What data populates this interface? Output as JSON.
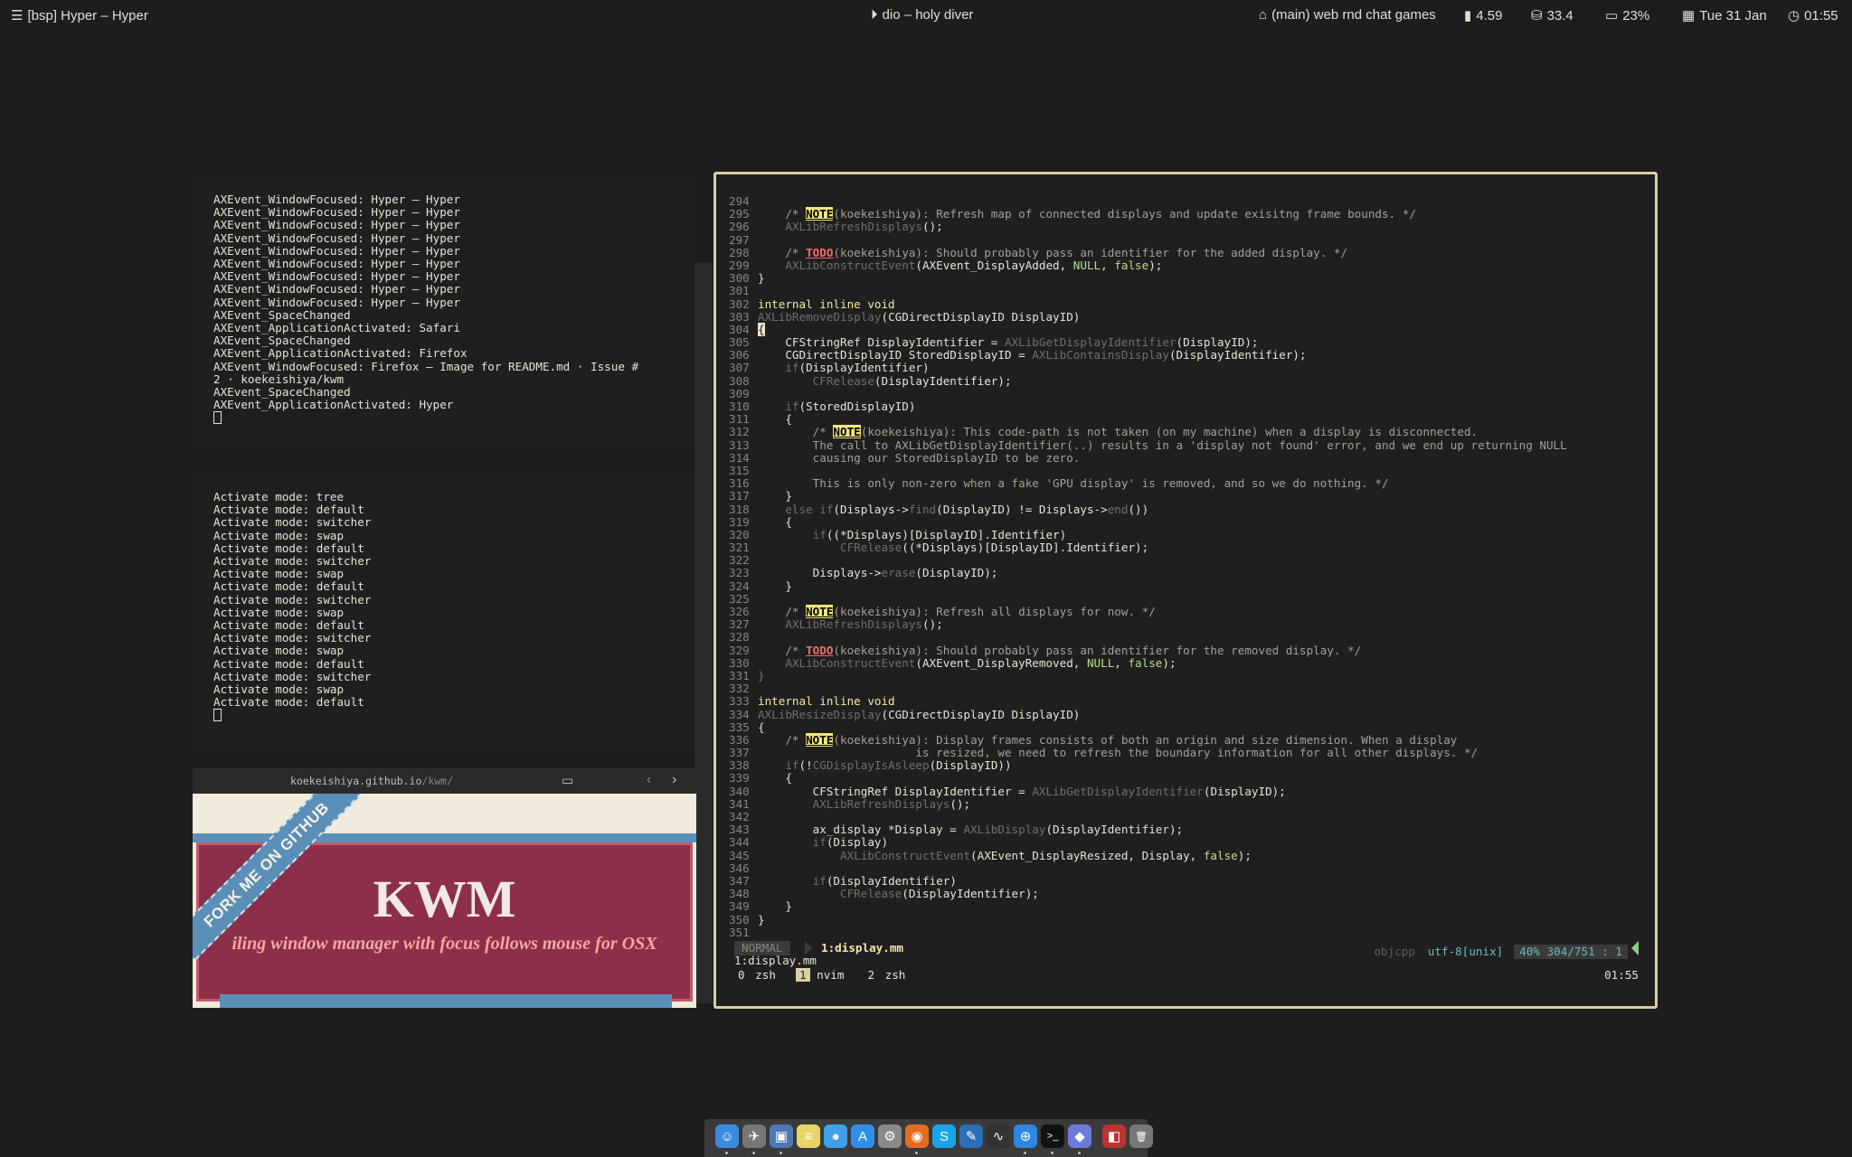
{
  "topbar": {
    "left_title": "[bsp] Hyper – Hyper",
    "now_playing": "dio – holy diver",
    "git_branch": "(main) web rnd chat games",
    "load": "4.59",
    "disk": "33.4",
    "battery": "23%",
    "date": "Tue 31 Jan",
    "time": "01:55"
  },
  "pane_events": {
    "lines": [
      "AXEvent_WindowFocused: Hyper – Hyper",
      "AXEvent_WindowFocused: Hyper – Hyper",
      "AXEvent_WindowFocused: Hyper – Hyper",
      "AXEvent_WindowFocused: Hyper – Hyper",
      "AXEvent_WindowFocused: Hyper – Hyper",
      "AXEvent_WindowFocused: Hyper – Hyper",
      "AXEvent_WindowFocused: Hyper – Hyper",
      "AXEvent_WindowFocused: Hyper – Hyper",
      "AXEvent_WindowFocused: Hyper – Hyper",
      "AXEvent_SpaceChanged",
      "AXEvent_ApplicationActivated: Safari",
      "AXEvent_SpaceChanged",
      "AXEvent_ApplicationActivated: Firefox",
      "AXEvent_WindowFocused: Firefox – Image for README.md · Issue #",
      "2 · koekeishiya/kwm",
      "AXEvent_SpaceChanged",
      "AXEvent_ApplicationActivated: Hyper"
    ]
  },
  "pane_modes": {
    "lines": [
      "Activate mode: tree",
      "Activate mode: default",
      "Activate mode: switcher",
      "Activate mode: swap",
      "Activate mode: default",
      "Activate mode: switcher",
      "Activate mode: swap",
      "Activate mode: default",
      "Activate mode: switcher",
      "Activate mode: swap",
      "Activate mode: default",
      "Activate mode: switcher",
      "Activate mode: swap",
      "Activate mode: default",
      "Activate mode: switcher",
      "Activate mode: swap",
      "Activate mode: default"
    ]
  },
  "browser": {
    "url_host": "koekeishiya.github.io",
    "url_path": "/kwm/",
    "page_title": "KWM",
    "page_subtitle": "iling window manager with focus follows mouse for OSX",
    "ribbon": "FORK ME ON GITHUB"
  },
  "editor": {
    "code_lines": [
      {
        "n": "294",
        "segs": []
      },
      {
        "n": "295",
        "segs": [
          {
            "t": "    /* ",
            "c": "cm"
          },
          {
            "t": "NOTE",
            "c": "note"
          },
          {
            "t": "(koekeishiya): Refresh map of connected displays and update exisitng frame bounds. */",
            "c": "cm"
          }
        ]
      },
      {
        "n": "296",
        "segs": [
          {
            "t": "    AXLibRefreshDisplays",
            "c": "fn"
          },
          {
            "t": "();",
            "c": ""
          }
        ]
      },
      {
        "n": "297",
        "segs": []
      },
      {
        "n": "298",
        "segs": [
          {
            "t": "    /* ",
            "c": "cm"
          },
          {
            "t": "TODO",
            "c": "todo"
          },
          {
            "t": "(koekeishiya): Should probably pass an identifier for the added display. */",
            "c": "cm"
          }
        ]
      },
      {
        "n": "299",
        "segs": [
          {
            "t": "    AXLibConstructEvent",
            "c": "fn"
          },
          {
            "t": "(AXEvent_DisplayAdded, ",
            "c": ""
          },
          {
            "t": "NULL",
            "c": "lit"
          },
          {
            "t": ", ",
            "c": ""
          },
          {
            "t": "false",
            "c": "lit"
          },
          {
            "t": ");",
            "c": ""
          }
        ]
      },
      {
        "n": "300",
        "segs": [
          {
            "t": "}",
            "c": ""
          }
        ]
      },
      {
        "n": "301",
        "segs": []
      },
      {
        "n": "302",
        "segs": [
          {
            "t": "internal inline void",
            "c": "kw"
          }
        ]
      },
      {
        "n": "303",
        "segs": [
          {
            "t": "AXLibRemoveDisplay",
            "c": "fn"
          },
          {
            "t": "(CGDirectDisplayID DisplayID)",
            "c": ""
          }
        ]
      },
      {
        "n": "304",
        "segs": [
          {
            "t": "{",
            "c": "cur"
          }
        ]
      },
      {
        "n": "305",
        "segs": [
          {
            "t": "    CFStringRef DisplayIdentifier = ",
            "c": ""
          },
          {
            "t": "AXLibGetDisplayIdentifier",
            "c": "fn"
          },
          {
            "t": "(DisplayID);",
            "c": ""
          }
        ]
      },
      {
        "n": "306",
        "segs": [
          {
            "t": "    CGDirectDisplayID StoredDisplayID = ",
            "c": ""
          },
          {
            "t": "AXLibContainsDisplay",
            "c": "fn"
          },
          {
            "t": "(DisplayIdentifier);",
            "c": ""
          }
        ]
      },
      {
        "n": "307",
        "segs": [
          {
            "t": "    ",
            "c": ""
          },
          {
            "t": "if",
            "c": "fn"
          },
          {
            "t": "(DisplayIdentifier)",
            "c": ""
          }
        ]
      },
      {
        "n": "308",
        "segs": [
          {
            "t": "        CFRelease",
            "c": "fn"
          },
          {
            "t": "(DisplayIdentifier);",
            "c": ""
          }
        ]
      },
      {
        "n": "309",
        "segs": []
      },
      {
        "n": "310",
        "segs": [
          {
            "t": "    ",
            "c": ""
          },
          {
            "t": "if",
            "c": "fn"
          },
          {
            "t": "(StoredDisplayID)",
            "c": ""
          }
        ]
      },
      {
        "n": "311",
        "segs": [
          {
            "t": "    {",
            "c": ""
          }
        ]
      },
      {
        "n": "312",
        "segs": [
          {
            "t": "        /* ",
            "c": "cm"
          },
          {
            "t": "NOTE",
            "c": "note"
          },
          {
            "t": "(koekeishiya): This code-path is not taken (on my machine) when a display is disconnected.",
            "c": "cm"
          }
        ]
      },
      {
        "n": "313",
        "segs": [
          {
            "t": "        The call to AXLibGetDisplayIdentifier(..) results in a 'display not found' error, and we end up returning NULL",
            "c": "cm"
          }
        ]
      },
      {
        "n": "314",
        "segs": [
          {
            "t": "        causing our StoredDisplayID to be zero.",
            "c": "cm"
          }
        ]
      },
      {
        "n": "315",
        "segs": []
      },
      {
        "n": "316",
        "segs": [
          {
            "t": "        This is only non-zero when a fake 'GPU display' is removed, and so we do nothing. */",
            "c": "cm"
          }
        ]
      },
      {
        "n": "317",
        "segs": [
          {
            "t": "    }",
            "c": ""
          }
        ]
      },
      {
        "n": "318",
        "segs": [
          {
            "t": "    else if",
            "c": "fn"
          },
          {
            "t": "(Displays->",
            "c": ""
          },
          {
            "t": "find",
            "c": "fn"
          },
          {
            "t": "(DisplayID) != Displays->",
            "c": ""
          },
          {
            "t": "end",
            "c": "fn"
          },
          {
            "t": "())",
            "c": ""
          }
        ]
      },
      {
        "n": "319",
        "segs": [
          {
            "t": "    {",
            "c": ""
          }
        ]
      },
      {
        "n": "320",
        "segs": [
          {
            "t": "        ",
            "c": ""
          },
          {
            "t": "if",
            "c": "fn"
          },
          {
            "t": "((*Displays)[DisplayID].Identifier)",
            "c": ""
          }
        ]
      },
      {
        "n": "321",
        "segs": [
          {
            "t": "            CFRelease",
            "c": "fn"
          },
          {
            "t": "((*Displays)[DisplayID].Identifier);",
            "c": ""
          }
        ]
      },
      {
        "n": "322",
        "segs": []
      },
      {
        "n": "323",
        "segs": [
          {
            "t": "        Displays->",
            "c": ""
          },
          {
            "t": "erase",
            "c": "fn"
          },
          {
            "t": "(DisplayID);",
            "c": ""
          }
        ]
      },
      {
        "n": "324",
        "segs": [
          {
            "t": "    }",
            "c": ""
          }
        ]
      },
      {
        "n": "325",
        "segs": []
      },
      {
        "n": "326",
        "segs": [
          {
            "t": "    /* ",
            "c": "cm"
          },
          {
            "t": "NOTE",
            "c": "note"
          },
          {
            "t": "(koekeishiya): Refresh all displays for now. */",
            "c": "cm"
          }
        ]
      },
      {
        "n": "327",
        "segs": [
          {
            "t": "    AXLibRefreshDisplays",
            "c": "fn"
          },
          {
            "t": "();",
            "c": ""
          }
        ]
      },
      {
        "n": "328",
        "segs": []
      },
      {
        "n": "329",
        "segs": [
          {
            "t": "    /* ",
            "c": "cm"
          },
          {
            "t": "TODO",
            "c": "todo"
          },
          {
            "t": "(koekeishiya): Should probably pass an identifier for the removed display. */",
            "c": "cm"
          }
        ]
      },
      {
        "n": "330",
        "segs": [
          {
            "t": "    AXLibConstructEvent",
            "c": "fn"
          },
          {
            "t": "(AXEvent_DisplayRemoved, ",
            "c": ""
          },
          {
            "t": "NULL",
            "c": "lit"
          },
          {
            "t": ", ",
            "c": ""
          },
          {
            "t": "false",
            "c": "lit"
          },
          {
            "t": ");",
            "c": ""
          }
        ]
      },
      {
        "n": "331",
        "segs": [
          {
            "t": "}",
            "c": "fn"
          }
        ]
      },
      {
        "n": "332",
        "segs": []
      },
      {
        "n": "333",
        "segs": [
          {
            "t": "internal inline void",
            "c": "kw"
          }
        ]
      },
      {
        "n": "334",
        "segs": [
          {
            "t": "AXLibResizeDisplay",
            "c": "fn"
          },
          {
            "t": "(CGDirectDisplayID DisplayID)",
            "c": ""
          }
        ]
      },
      {
        "n": "335",
        "segs": [
          {
            "t": "{",
            "c": ""
          }
        ]
      },
      {
        "n": "336",
        "segs": [
          {
            "t": "    /* ",
            "c": "cm"
          },
          {
            "t": "NOTE",
            "c": "note"
          },
          {
            "t": "(koekeishiya): Display frames consists of both an origin and size dimension. When a display",
            "c": "cm"
          }
        ]
      },
      {
        "n": "337",
        "segs": [
          {
            "t": "                       is resized, we need to refresh the boundary information for all other displays. */",
            "c": "cm"
          }
        ]
      },
      {
        "n": "338",
        "segs": [
          {
            "t": "    ",
            "c": ""
          },
          {
            "t": "if",
            "c": "fn"
          },
          {
            "t": "(!",
            "c": ""
          },
          {
            "t": "CGDisplayIsAsleep",
            "c": "fn"
          },
          {
            "t": "(DisplayID))",
            "c": ""
          }
        ]
      },
      {
        "n": "339",
        "segs": [
          {
            "t": "    {",
            "c": ""
          }
        ]
      },
      {
        "n": "340",
        "segs": [
          {
            "t": "        CFStringRef DisplayIdentifier = ",
            "c": ""
          },
          {
            "t": "AXLibGetDisplayIdentifier",
            "c": "fn"
          },
          {
            "t": "(DisplayID);",
            "c": ""
          }
        ]
      },
      {
        "n": "341",
        "segs": [
          {
            "t": "        AXLibRefreshDisplays",
            "c": "fn"
          },
          {
            "t": "();",
            "c": ""
          }
        ]
      },
      {
        "n": "342",
        "segs": []
      },
      {
        "n": "343",
        "segs": [
          {
            "t": "        ax_display *Display = ",
            "c": ""
          },
          {
            "t": "AXLibDisplay",
            "c": "fn"
          },
          {
            "t": "(DisplayIdentifier);",
            "c": ""
          }
        ]
      },
      {
        "n": "344",
        "segs": [
          {
            "t": "        ",
            "c": ""
          },
          {
            "t": "if",
            "c": "fn"
          },
          {
            "t": "(Display)",
            "c": ""
          }
        ]
      },
      {
        "n": "345",
        "segs": [
          {
            "t": "            AXLibConstructEvent",
            "c": "fn"
          },
          {
            "t": "(AXEvent_DisplayResized, Display, ",
            "c": ""
          },
          {
            "t": "false",
            "c": "lit"
          },
          {
            "t": ");",
            "c": ""
          }
        ]
      },
      {
        "n": "346",
        "segs": []
      },
      {
        "n": "347",
        "segs": [
          {
            "t": "        ",
            "c": ""
          },
          {
            "t": "if",
            "c": "fn"
          },
          {
            "t": "(DisplayIdentifier)",
            "c": ""
          }
        ]
      },
      {
        "n": "348",
        "segs": [
          {
            "t": "            CFRelease",
            "c": "fn"
          },
          {
            "t": "(DisplayIdentifier);",
            "c": ""
          }
        ]
      },
      {
        "n": "349",
        "segs": [
          {
            "t": "    }",
            "c": ""
          }
        ]
      },
      {
        "n": "350",
        "segs": [
          {
            "t": "}",
            "c": ""
          }
        ]
      },
      {
        "n": "351",
        "segs": []
      }
    ],
    "status": {
      "mode": "NORMAL",
      "file": "1:display.mm",
      "filetype": "objcpp",
      "encoding": "utf-8[unix]",
      "percent": "40%",
      "position": "304/751",
      "column": "1"
    },
    "cmdline": "1:display.mm",
    "tmux": {
      "windows": [
        {
          "idx": "0",
          "name": "zsh",
          "active": false
        },
        {
          "idx": "1",
          "name": "nvim",
          "active": true
        },
        {
          "idx": "2",
          "name": "zsh",
          "active": false
        }
      ],
      "clock": "01:55"
    }
  },
  "dock": {
    "apps": [
      {
        "name": "finder-icon",
        "glyph": "☺",
        "color": "#3d8be0"
      },
      {
        "name": "launchpad-icon",
        "glyph": "✈",
        "color": "#777"
      },
      {
        "name": "preview-icon",
        "glyph": "▣",
        "color": "#4b79b4"
      },
      {
        "name": "notes-icon",
        "glyph": "≡",
        "color": "#e8d46a"
      },
      {
        "name": "messages-icon",
        "glyph": "●",
        "color": "#3fa0e8"
      },
      {
        "name": "app-store-icon",
        "glyph": "A",
        "color": "#2f8fe8"
      },
      {
        "name": "system-preferences-icon",
        "glyph": "⚙",
        "color": "#8a8a8a"
      },
      {
        "name": "firefox-icon",
        "glyph": "◉",
        "color": "#e56b1f"
      },
      {
        "name": "skype-icon",
        "glyph": "S",
        "color": "#19a4e8"
      },
      {
        "name": "xcode-icon",
        "glyph": "✎",
        "color": "#2a6fb8"
      },
      {
        "name": "activity-monitor-icon",
        "glyph": "∿",
        "color": "#333"
      },
      {
        "name": "safari-icon",
        "glyph": "⊕",
        "color": "#2f86e0"
      },
      {
        "name": "terminal-icon",
        "glyph": ">_",
        "color": "#111"
      },
      {
        "name": "discord-icon",
        "glyph": "◆",
        "color": "#6e7ad8"
      },
      {
        "name": "photo-booth-icon",
        "glyph": "◧",
        "color": "#b33"
      },
      {
        "name": "trash-icon",
        "glyph": "🗑",
        "color": "#777"
      }
    ]
  }
}
